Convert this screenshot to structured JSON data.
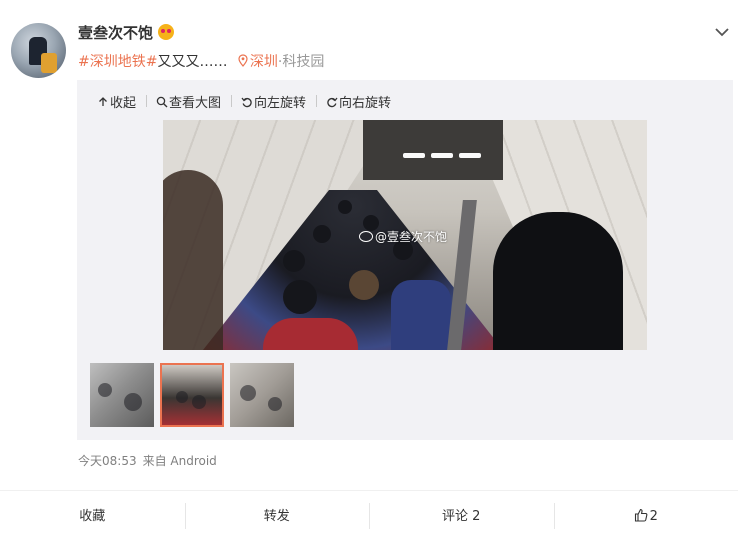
{
  "post": {
    "username": "壹叁次不饱",
    "emoji": "emoji-icon",
    "content": {
      "topic": "#深圳地铁#",
      "text": "又又又……",
      "location_city": "深圳",
      "location_separator": "·",
      "location_place": "科技园"
    }
  },
  "media_toolbar": {
    "collapse_label": "收起",
    "view_large_label": "查看大图",
    "rotate_left_label": "向左旋转",
    "rotate_right_label": "向右旋转"
  },
  "photo": {
    "watermark": "@壹叁次不饱"
  },
  "thumbnails": {
    "count": 3,
    "selected_index": 1
  },
  "meta": {
    "time": "今天08:53",
    "source": "来自 Android"
  },
  "actions": {
    "favorite_label": "收藏",
    "repost_label": "转发",
    "comment_label": "评论 2",
    "like_count": "2"
  },
  "colors": {
    "accent": "#eb7350",
    "text": "#333333",
    "muted": "#808080",
    "media_bg": "#f2f2f5"
  }
}
